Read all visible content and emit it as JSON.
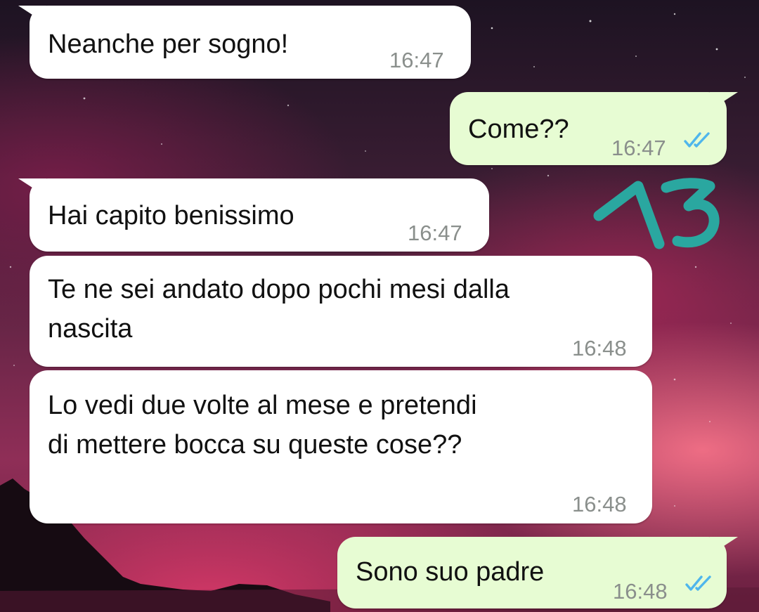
{
  "chat": {
    "messages": [
      {
        "direction": "incoming",
        "lines": [
          "Neanche per sogno!"
        ],
        "time": "16:47"
      },
      {
        "direction": "outgoing",
        "lines": [
          "Come??"
        ],
        "time": "16:47",
        "status": "read-double-check-icon"
      },
      {
        "direction": "incoming",
        "lines": [
          "Hai capito benissimo"
        ],
        "time": "16:47"
      },
      {
        "direction": "incoming",
        "lines": [
          "Te ne sei andato dopo pochi mesi dalla",
          "nascita"
        ],
        "time": "16:48"
      },
      {
        "direction": "incoming",
        "lines": [
          "Lo vedi due volte al mese e pretendi",
          "di mettere bocca su queste cose??"
        ],
        "time": "16:48"
      },
      {
        "direction": "outgoing",
        "lines": [
          "Sono suo padre"
        ],
        "time": "16:48",
        "status": "read-double-check-icon"
      }
    ]
  },
  "annotation": {
    "text": "13",
    "color": "#2aa7a0"
  },
  "colors": {
    "incoming_bubble": "#ffffff",
    "outgoing_bubble": "#e7fcd3",
    "read_ticks": "#4fb6ec",
    "timestamp": "#8a8f8c"
  }
}
